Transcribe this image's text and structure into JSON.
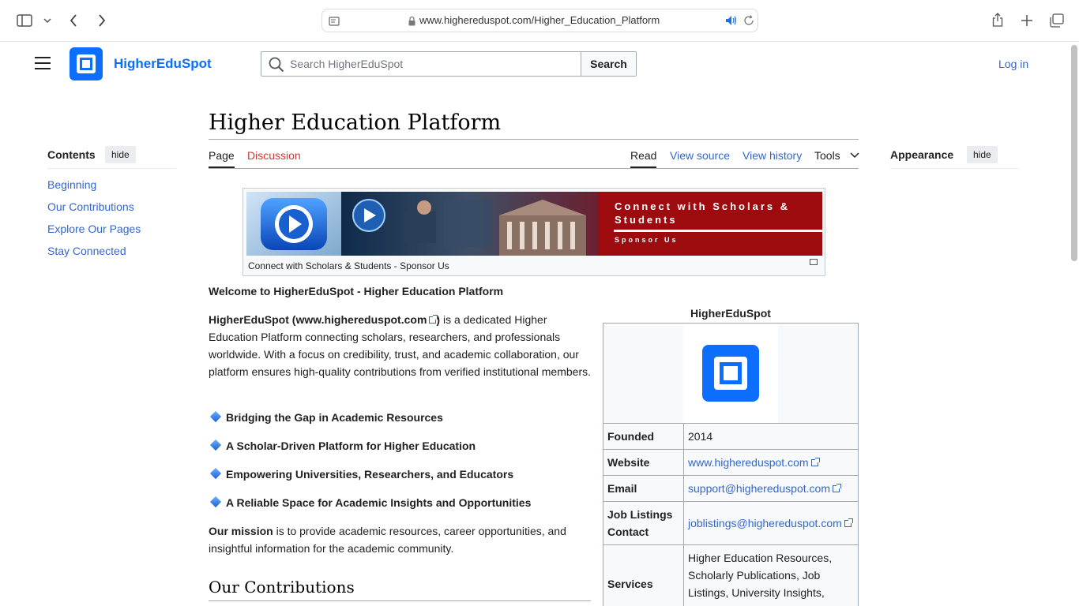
{
  "browser": {
    "url": "www.highereduspot.com/Higher_Education_Platform"
  },
  "header": {
    "site_name": "HigherEduSpot",
    "search_placeholder": "Search HigherEduSpot",
    "search_button": "Search",
    "login": "Log in"
  },
  "toc": {
    "title": "Contents",
    "hide": "hide",
    "items": [
      "Beginning",
      "Our Contributions",
      "Explore Our Pages",
      "Stay Connected"
    ]
  },
  "appearance": {
    "title": "Appearance",
    "hide": "hide"
  },
  "page": {
    "title": "Higher Education Platform",
    "tabs": {
      "page": "Page",
      "discussion": "Discussion",
      "read": "Read",
      "view_source": "View source",
      "view_history": "View history",
      "tools": "Tools"
    }
  },
  "banner": {
    "headline_line1": "Connect with Scholars &",
    "headline_line2": "Students",
    "subline": "Sponsor Us",
    "caption": "Connect with Scholars & Students - Sponsor Us"
  },
  "content": {
    "welcome": "Welcome to HigherEduSpot - Higher Education Platform",
    "intro_name": "HigherEduSpot",
    "intro_link": "www.highereduspot.com",
    "intro_rest": " is a dedicated Higher Education Platform connecting scholars, researchers, and professionals worldwide. With a focus on credibility, trust, and academic collaboration, our platform ensures high-quality contributions from verified institutional members.",
    "bullets": [
      "Bridging the Gap in Academic Resources",
      "A Scholar-Driven Platform for Higher Education",
      "Empowering Universities, Researchers, and Educators",
      "A Reliable Space for Academic Insights and Opportunities"
    ],
    "mission_bold": "Our mission",
    "mission_rest": " is to provide academic resources, career opportunities, and insightful information for the academic community.",
    "section_heading": "Our Contributions"
  },
  "infobox": {
    "title": "HigherEduSpot",
    "rows": [
      {
        "key": "Founded",
        "value": "2014"
      },
      {
        "key": "Website",
        "value": "www.highereduspot.com"
      },
      {
        "key": "Email",
        "value": "support@highereduspot.com"
      },
      {
        "key": "Job Listings Contact",
        "value": "joblistings@highereduspot.com"
      },
      {
        "key": "Services",
        "value": "Higher Education Resources, Scholarly Publications, Job Listings, University Insights, Career Development, Academic"
      }
    ]
  },
  "colors": {
    "brand": "#0d6efd",
    "link": "#3366cc",
    "redlink": "#d73333",
    "banner_red": "#9e0b0f"
  }
}
